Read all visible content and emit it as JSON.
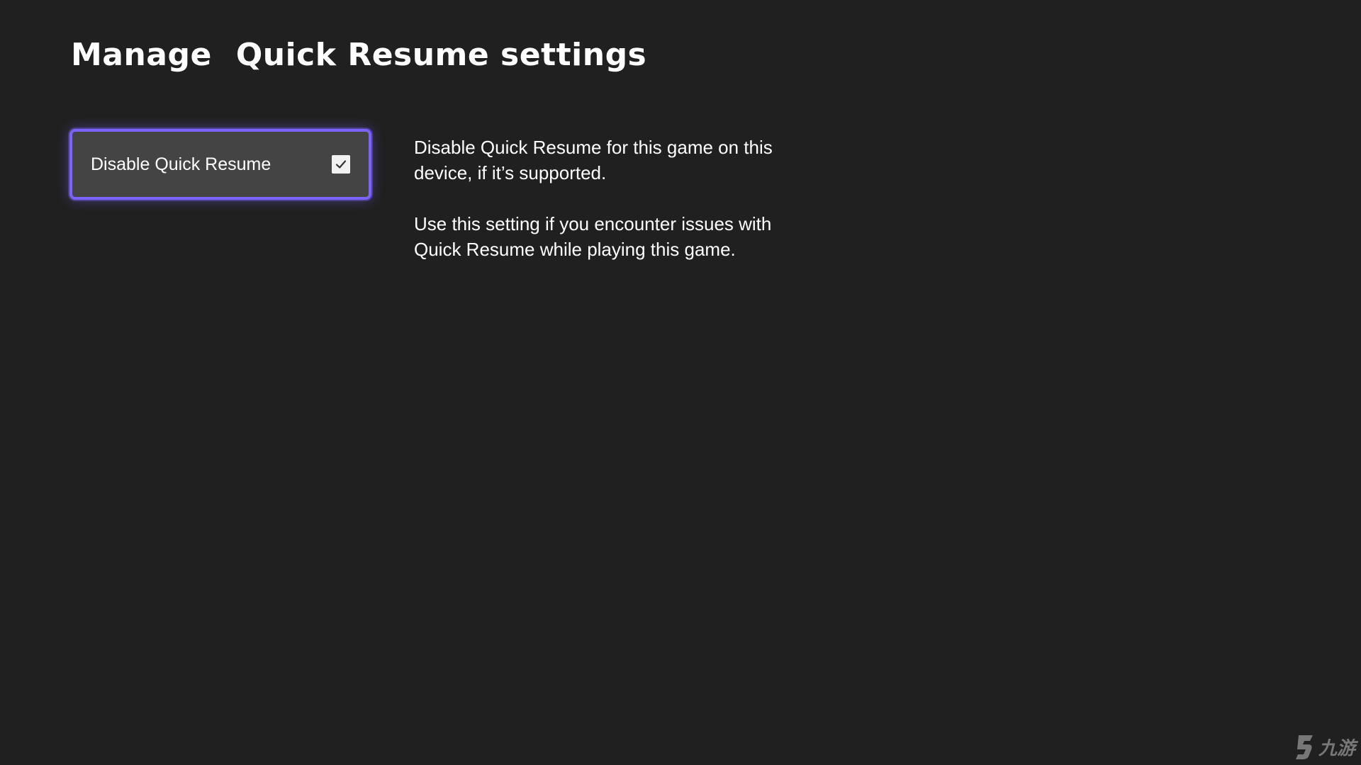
{
  "header": {
    "title_part1": "Manage",
    "title_part2": "Quick Resume settings"
  },
  "setting": {
    "label": "Disable Quick Resume",
    "checked": true,
    "checkbox_icon": "checkmark-icon"
  },
  "description": {
    "line1": "Disable Quick Resume for this game on this device, if it’s supported.",
    "line2": "Use this setting if you encounter issues with Quick Resume while playing this game."
  },
  "watermark": {
    "text": "九游"
  },
  "colors": {
    "background": "#202020",
    "tile": "#444444",
    "focus_border": "#7b63ff",
    "text": "#ffffff"
  }
}
